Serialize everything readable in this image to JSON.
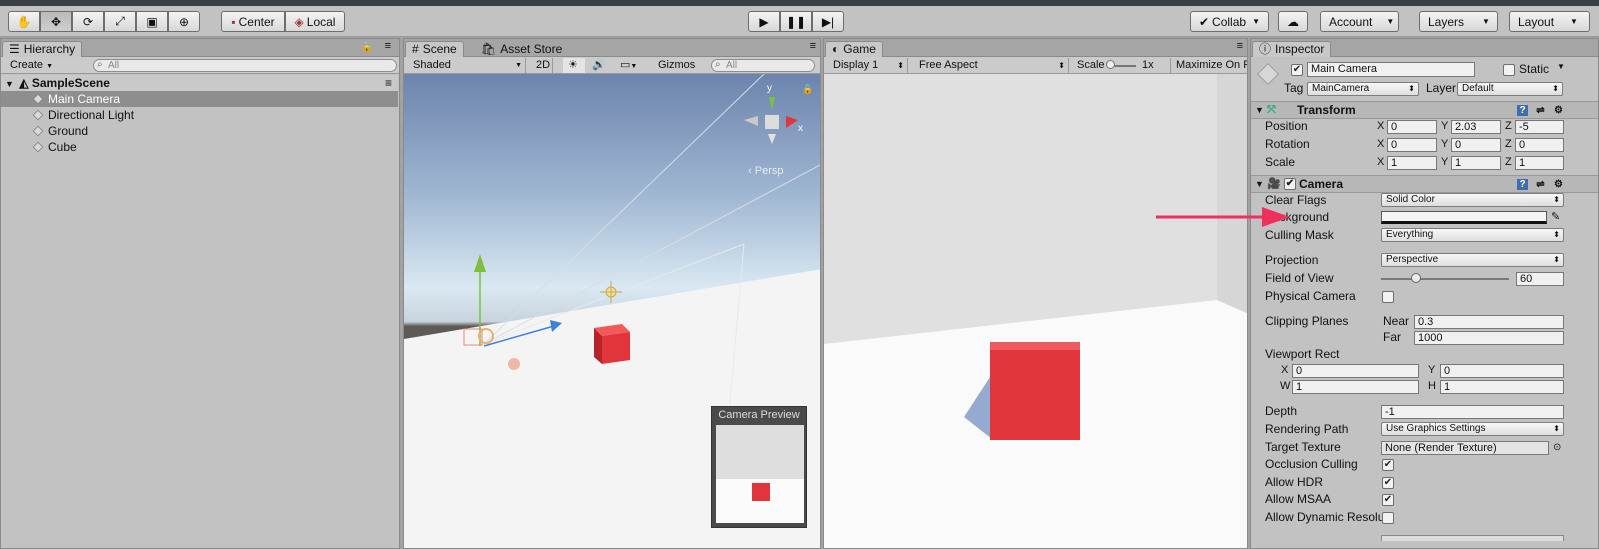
{
  "toolbar": {
    "tools": [
      "hand-icon",
      "move-icon",
      "rotate-icon",
      "scale-icon",
      "rect-icon",
      "transform-icon"
    ],
    "pivot": "Center",
    "space": "Local",
    "play": [
      "play-icon",
      "pause-icon",
      "step-icon"
    ],
    "collab": "Collab",
    "cloud": "cloud-icon",
    "account": "Account",
    "layers": "Layers",
    "layout": "Layout"
  },
  "hierarchy": {
    "tab": "Hierarchy",
    "create": "Create",
    "search": "All",
    "scene": "SampleScene",
    "items": [
      "Main Camera",
      "Directional Light",
      "Ground",
      "Cube"
    ]
  },
  "scene": {
    "tab": "Scene",
    "store_tab": "Asset Store",
    "shading": "Shaded",
    "mode2d": "2D",
    "gizmos": "Gizmos",
    "search": "All",
    "persp": "Persp",
    "axis_x": "x",
    "axis_y": "y",
    "camera_preview": "Camera Preview"
  },
  "game": {
    "tab": "Game",
    "display": "Display 1",
    "aspect": "Free Aspect",
    "scale_label": "Scale",
    "scale_value": "1x",
    "maximize": "Maximize On Pl"
  },
  "inspector": {
    "tab": "Inspector",
    "object_name": "Main Camera",
    "static": "Static",
    "tag_label": "Tag",
    "tag": "MainCamera",
    "layer_label": "Layer",
    "layer": "Default",
    "transform": {
      "title": "Transform",
      "rows": [
        {
          "label": "Position",
          "x": "0",
          "y": "2.03",
          "z": "-5"
        },
        {
          "label": "Rotation",
          "x": "0",
          "y": "0",
          "z": "0"
        },
        {
          "label": "Scale",
          "x": "1",
          "y": "1",
          "z": "1"
        }
      ]
    },
    "camera": {
      "title": "Camera",
      "clear_flags": "Clear Flags",
      "clear_flags_value": "Solid Color",
      "background": "Background",
      "culling": "Culling Mask",
      "culling_value": "Everything",
      "projection": "Projection",
      "projection_value": "Perspective",
      "fov": "Field of View",
      "fov_value": "60",
      "fov_fraction": 0.27,
      "physical": "Physical Camera",
      "clipping": "Clipping Planes",
      "near_label": "Near",
      "near": "0.3",
      "far_label": "Far",
      "far": "1000",
      "viewport": "Viewport Rect",
      "vx": "0",
      "vy": "0",
      "vw": "1",
      "vh": "1",
      "depth": "Depth",
      "depth_value": "-1",
      "rendering": "Rendering Path",
      "rendering_value": "Use Graphics Settings",
      "target": "Target Texture",
      "target_value": "None (Render Texture)",
      "occlusion": "Occlusion Culling",
      "hdr": "Allow HDR",
      "msaa": "Allow MSAA",
      "dynamic": "Allow Dynamic Resolu"
    }
  },
  "colors": {
    "accent_arrow": "#f0305a",
    "cube": "#e2343b"
  }
}
